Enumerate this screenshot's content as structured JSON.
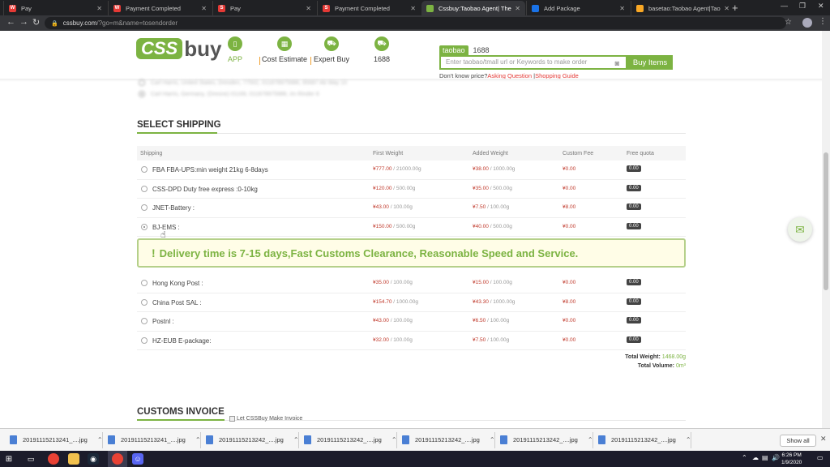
{
  "browser": {
    "tabs": [
      {
        "title": "Pay",
        "fav_color": "#e53935",
        "fav_letter": "W"
      },
      {
        "title": "Payment Completed",
        "fav_color": "#e53935",
        "fav_letter": "W"
      },
      {
        "title": "Pay",
        "fav_color": "#e53935",
        "fav_letter": "S"
      },
      {
        "title": "Payment Completed",
        "fav_color": "#e53935",
        "fav_letter": "S"
      },
      {
        "title": "Cssbuy:Taobao Agent| The best c",
        "fav_color": "#7cb342",
        "fav_letter": ""
      },
      {
        "title": "Add Package",
        "fav_color": "#1a73e8",
        "fav_letter": ""
      },
      {
        "title": "basetao:Taobao Agent|Taobao E",
        "fav_color": "#f9a825",
        "fav_letter": ""
      }
    ],
    "active_tab": 4,
    "url_host": "cssbuy.com",
    "url_rest": "/?go=m&name=tosendorder"
  },
  "header": {
    "logo_css": "CSS",
    "logo_buy": "buy",
    "nav": [
      {
        "label": "APP",
        "icon": "phone-icon"
      },
      {
        "label": "Cost Estimate",
        "icon": "calculator-icon"
      },
      {
        "label": "Expert Buy",
        "icon": "cart-icon"
      },
      {
        "label": "1688",
        "icon": "cart-icon"
      }
    ],
    "search": {
      "tab_active": "taobao",
      "tab_other": "1688",
      "placeholder": "Enter taobao/tmall url or Keywords to make order",
      "button": "Buy Items"
    },
    "help": {
      "prefix": "Don't know price?",
      "link1": "Asking Question",
      "link2": "Shopping Guide"
    }
  },
  "address": [
    "Carl Harris, United States, Dresden, 77502, 011878975986, 95687 Ab Way 10",
    "Carl Harris, Germany, (Dresne) 01169, 011878975986, Im Rinder 6"
  ],
  "shipping": {
    "title": "SELECT SHIPPING",
    "columns": {
      "shipping": "Shipping",
      "first": "First Weight",
      "added": "Added Weight",
      "custom": "Custom Fee",
      "free": "Free quota"
    },
    "rows": [
      {
        "name": "FBA FBA-UPS:min weight 21kg 6-8days",
        "first_price": "¥777.00",
        "first_unit": " / 21000.00g",
        "added_price": "¥38.00",
        "added_unit": " / 1000.00g",
        "custom": "¥0.00",
        "free": "0.00"
      },
      {
        "name": "CSS-DPD Duty free express :0-10kg",
        "first_price": "¥120.00",
        "first_unit": " / 500.00g",
        "added_price": "¥35.00",
        "added_unit": " / 500.00g",
        "custom": "¥0.00",
        "free": "0.00"
      },
      {
        "name": "JNET-Battery :",
        "first_price": "¥43.00",
        "first_unit": " / 100.00g",
        "added_price": "¥7.50",
        "added_unit": " / 100.00g",
        "custom": "¥8.00",
        "free": "0.00"
      },
      {
        "name": "BJ-EMS :",
        "first_price": "¥150.00",
        "first_unit": " / 500.00g",
        "added_price": "¥40.00",
        "added_unit": " / 500.00g",
        "custom": "¥0.00",
        "free": "0.00",
        "selected": true
      },
      {
        "name": "Hong Kong Post :",
        "first_price": "¥35.00",
        "first_unit": " / 100.00g",
        "added_price": "¥15.00",
        "added_unit": " / 100.00g",
        "custom": "¥0.00",
        "free": "0.00"
      },
      {
        "name": "China Post SAL :",
        "first_price": "¥154.70",
        "first_unit": " / 1000.00g",
        "added_price": "¥43.30",
        "added_unit": " / 1000.00g",
        "custom": "¥8.00",
        "free": "0.00"
      },
      {
        "name": "Postnl :",
        "first_price": "¥43.00",
        "first_unit": " / 100.00g",
        "added_price": "¥6.50",
        "added_unit": " / 100.00g",
        "custom": "¥0.00",
        "free": "0.00"
      },
      {
        "name": "HZ-EUB E-package:",
        "first_price": "¥32.00",
        "first_unit": " / 100.00g",
        "added_price": "¥7.50",
        "added_unit": " / 100.00g",
        "custom": "¥0.00",
        "free": "0.00"
      }
    ],
    "notice": "Delivery time is 7-15 days,Fast Customs Clearance, Reasonable Speed and Service.",
    "total_weight_label": "Total Weight:",
    "total_weight_value": "1468.00g",
    "total_volume_label": "Total Volume:",
    "total_volume_value": "0m³"
  },
  "invoice": {
    "title": "CUSTOMS INVOICE",
    "checkbox_label": "Let CSSBuy Make Invoice"
  },
  "downloads": {
    "files": [
      "20191115213241_....jpg",
      "20191115213241_....jpg",
      "20191115213242_....jpg",
      "20191115213242_....jpg",
      "20191115213242_....jpg",
      "20191115213242_....jpg",
      "20191115213242_....jpg"
    ],
    "show_all": "Show all"
  },
  "taskbar": {
    "time": "6:26 PM",
    "date": "1/9/2020"
  },
  "colors": {
    "brand": "#7cb342",
    "price": "#c0392b"
  }
}
